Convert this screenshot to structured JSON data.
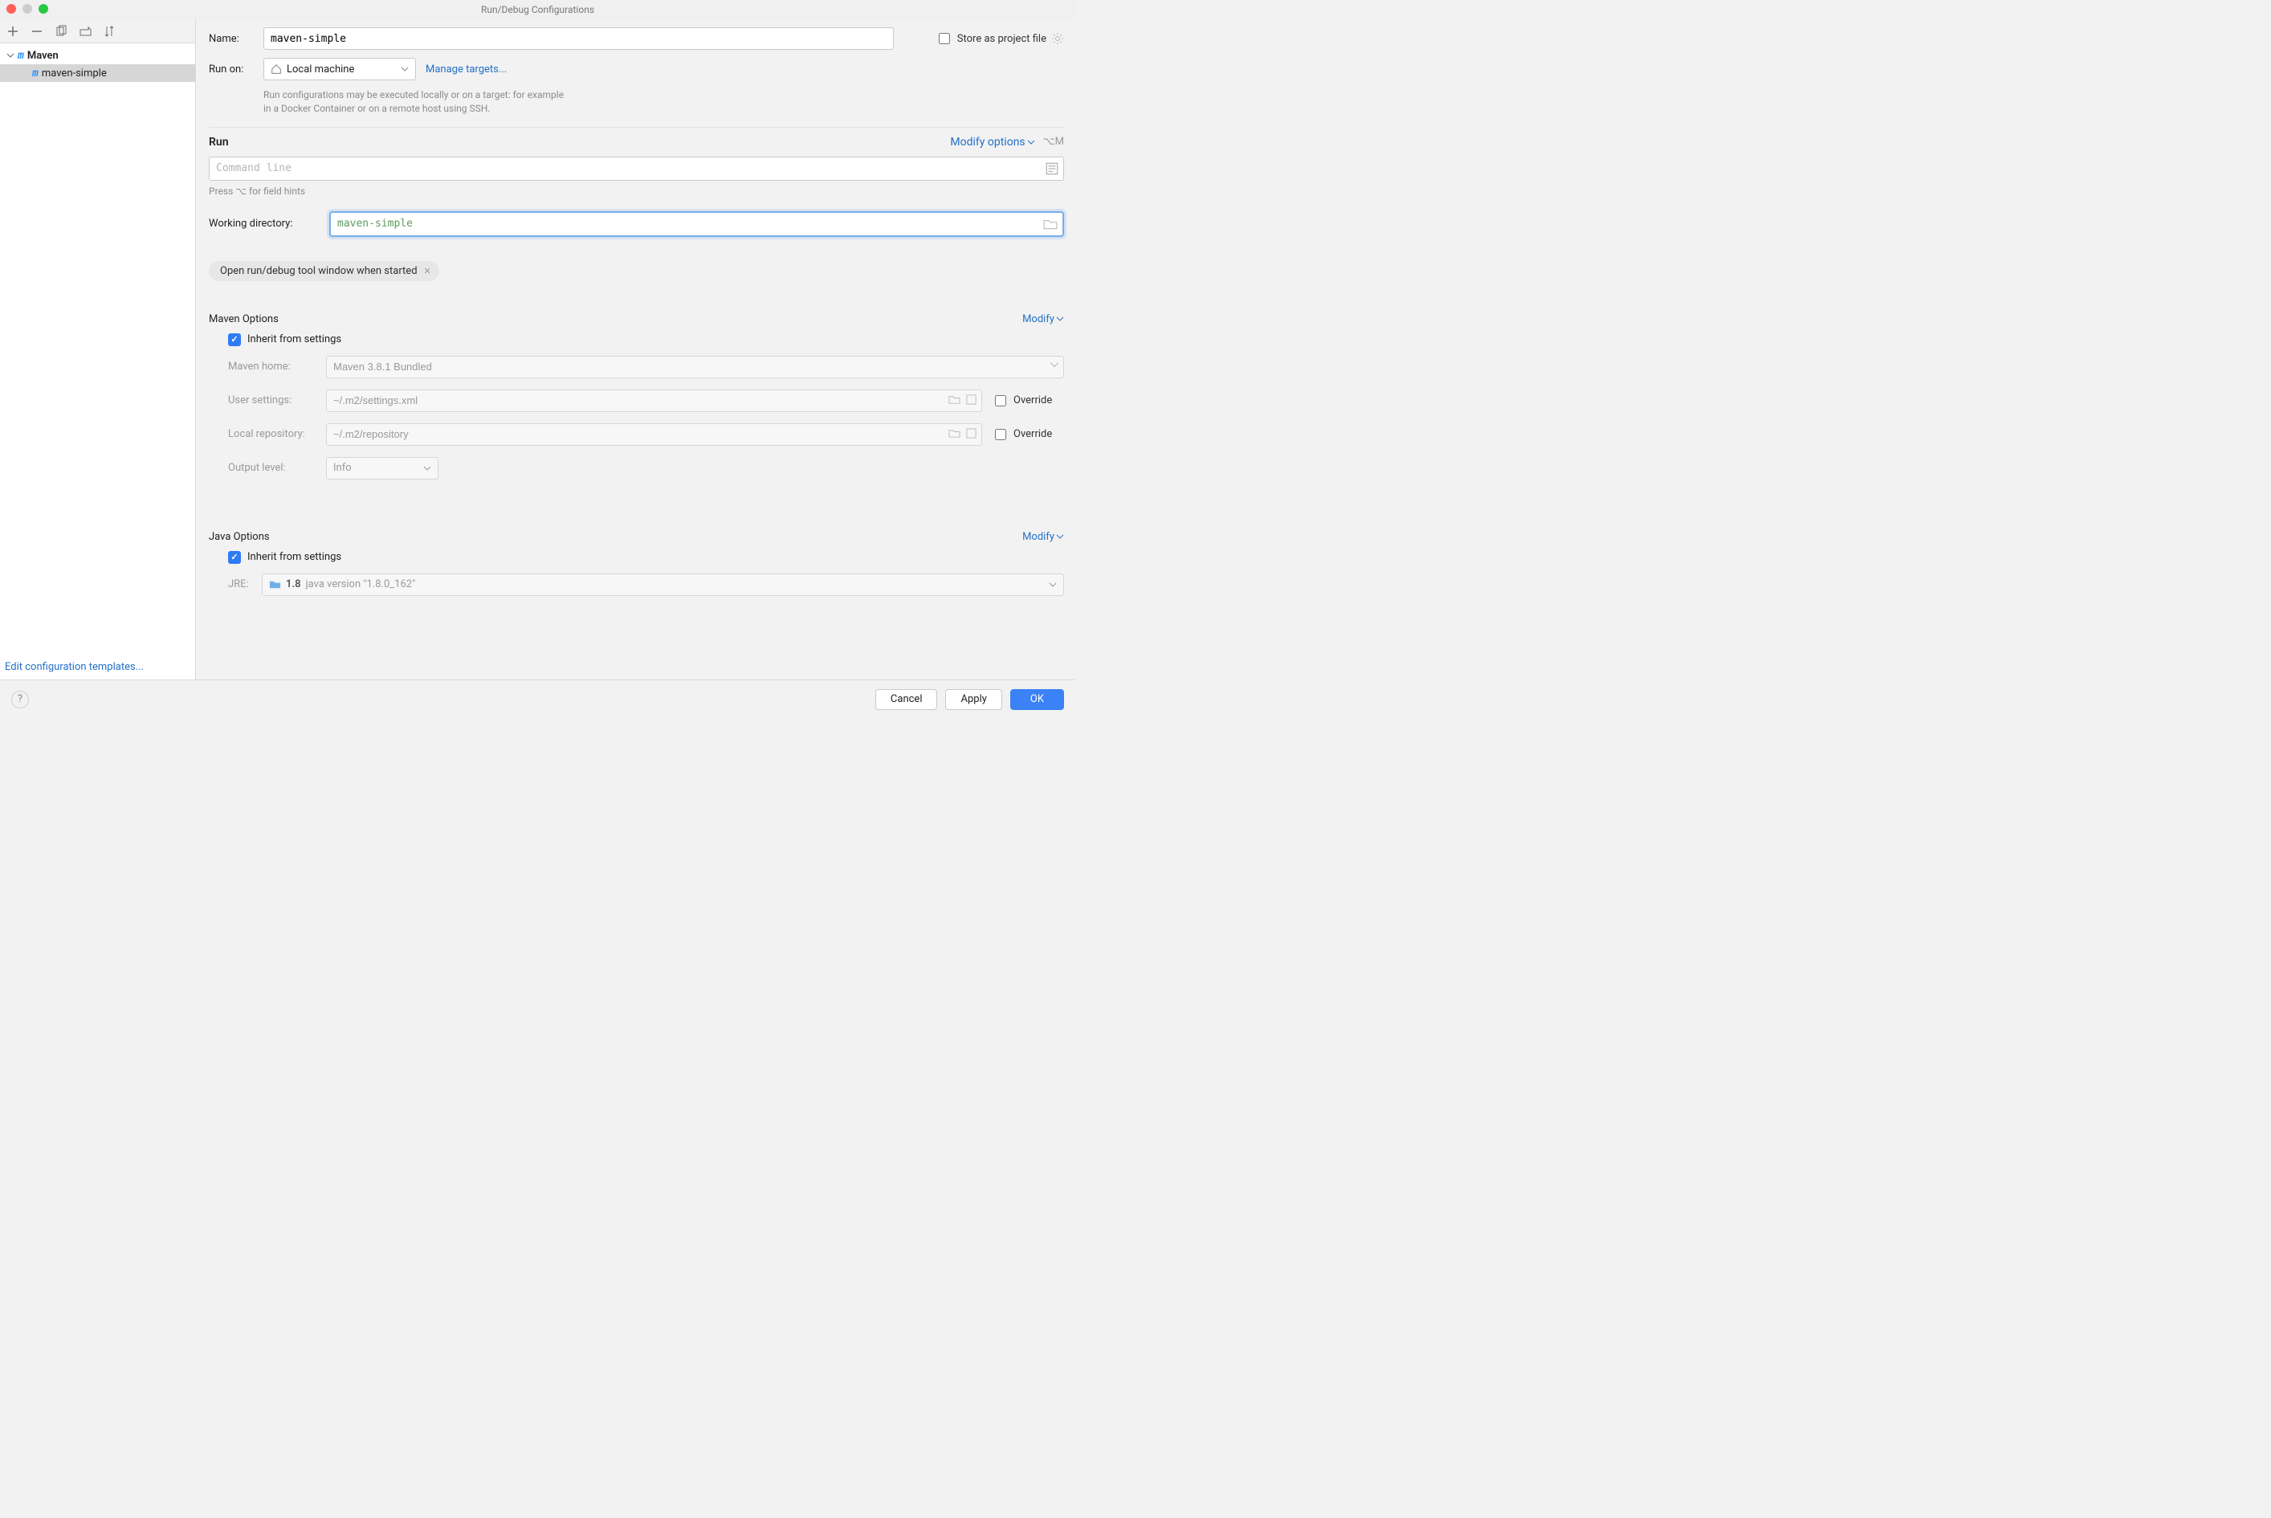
{
  "title": "Run/Debug Configurations",
  "sidebar": {
    "root_label": "Maven",
    "item_label": "maven-simple",
    "edit_templates": "Edit configuration templates..."
  },
  "form": {
    "name_label": "Name:",
    "name_value": "maven-simple",
    "store_label": "Store as project file",
    "runon_label": "Run on:",
    "runon_value": "Local machine",
    "manage_targets": "Manage targets...",
    "hint_line1": "Run configurations may be executed locally or on a target: for example",
    "hint_line2": "in a Docker Container or on a remote host using SSH."
  },
  "run": {
    "title": "Run",
    "modify_options": "Modify options",
    "shortcut": "⌥M",
    "cmd_placeholder": "Command line",
    "cmd_hint": "Press ⌥ for field hints",
    "wd_label": "Working directory:",
    "wd_value": "maven-simple",
    "chip": "Open run/debug tool window when started"
  },
  "maven": {
    "title": "Maven Options",
    "modify": "Modify",
    "inherit": "Inherit from settings",
    "home_label": "Maven home:",
    "home_value": "Maven 3.8.1 Bundled",
    "user_label": "User settings:",
    "user_value": "~/.m2/settings.xml",
    "repo_label": "Local repository:",
    "repo_value": "~/.m2/repository",
    "output_label": "Output level:",
    "output_value": "Info",
    "override": "Override"
  },
  "java": {
    "title": "Java Options",
    "modify": "Modify",
    "inherit": "Inherit from settings",
    "jre_label": "JRE:",
    "jre_bold": "1.8",
    "jre_rest": "java version \"1.8.0_162\""
  },
  "footer": {
    "cancel": "Cancel",
    "apply": "Apply",
    "ok": "OK"
  }
}
